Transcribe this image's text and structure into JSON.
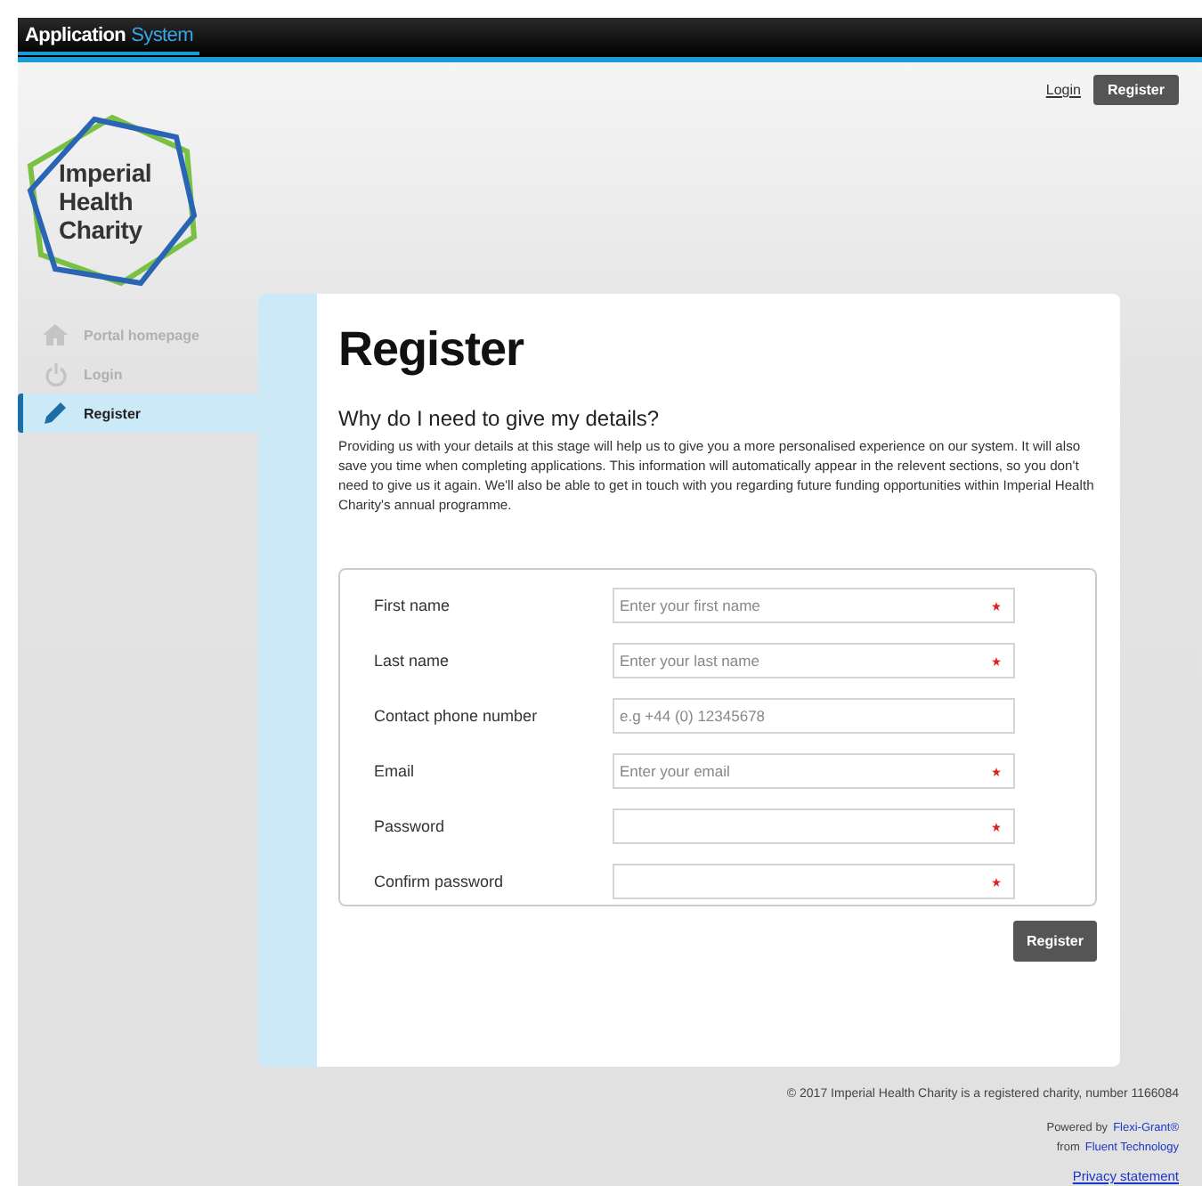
{
  "app_bar": {
    "title": "Application",
    "title_accent": "System"
  },
  "header": {
    "links": [
      {
        "label": "Login",
        "kind": "link"
      },
      {
        "label": "Register",
        "kind": "button"
      }
    ],
    "logo_text": "Imperial\nHealth\nCharity"
  },
  "sidebar": {
    "items": [
      {
        "label": "Portal homepage",
        "kind": "home",
        "selected": false
      },
      {
        "label": "Login",
        "kind": "power",
        "selected": false
      },
      {
        "label": "Register",
        "kind": "pencil",
        "selected": true
      }
    ]
  },
  "page": {
    "title": "Register",
    "subtitle": "Why do I need to give my details?",
    "intro": "Providing us with your details at this stage will help us to give you a more personalised experience on our system. It will also save you time when completing applications. This information will automatically appear in the relevent sections, so you don't need to give us it again. We'll also be able to get in touch with you regarding future funding opportunities within Imperial Health Charity's annual programme."
  },
  "form": {
    "fields": [
      {
        "label": "First name",
        "placeholder": "Enter your first name",
        "required": true
      },
      {
        "label": "Last name",
        "placeholder": "Enter your last name",
        "required": true
      },
      {
        "label": "Contact phone number",
        "placeholder": "e.g +44 (0) 12345678",
        "required": false
      },
      {
        "label": "Email",
        "placeholder": "Enter your email",
        "required": true
      },
      {
        "label": "Password",
        "required": true
      },
      {
        "label": "Confirm password",
        "required": true
      }
    ],
    "submit": "Register"
  },
  "footer": {
    "copyright": "© 2017 Imperial Health Charity is a registered charity, number 1166084",
    "powered_by": "Powered by",
    "product": "Flexi-Grant®",
    "from": "from",
    "vendor": "Fluent Technology",
    "privacy": "Privacy statement"
  }
}
